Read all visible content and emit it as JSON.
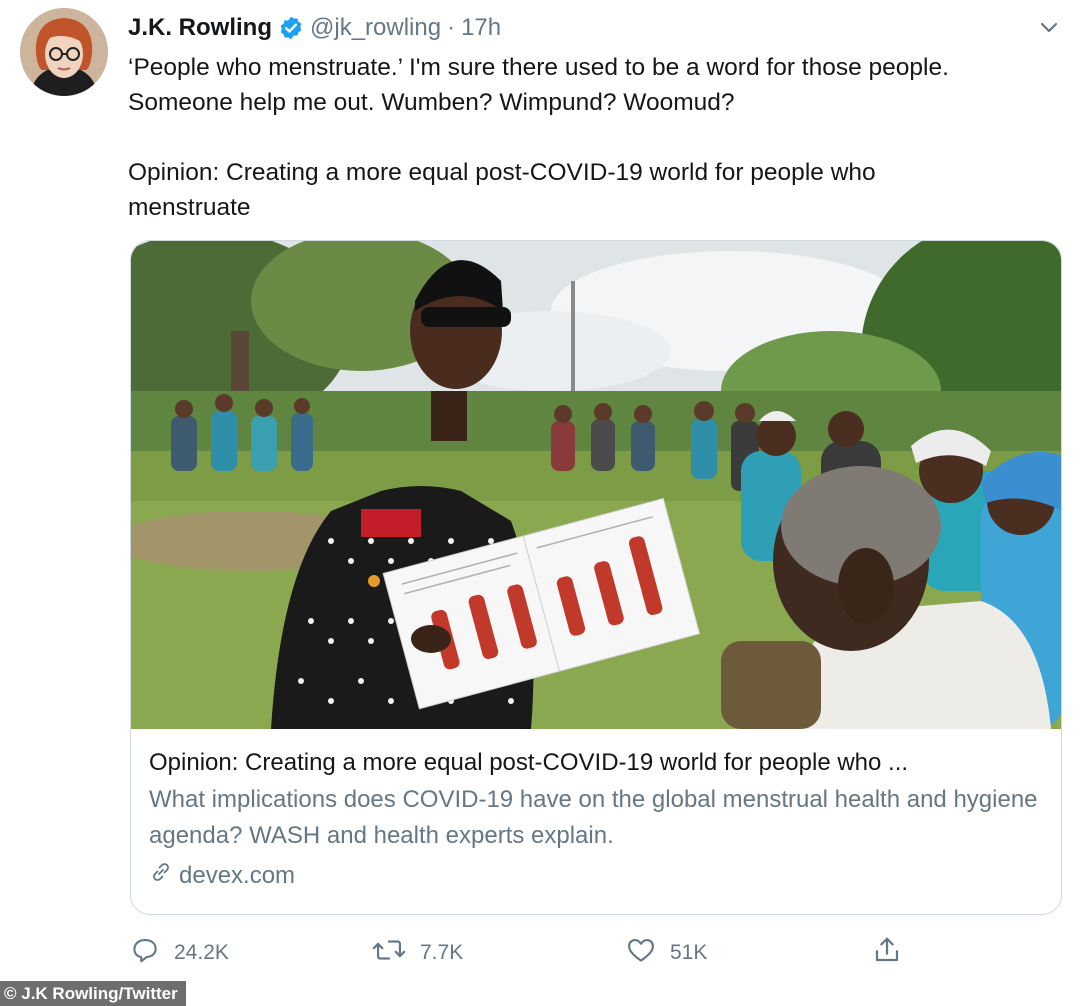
{
  "tweet": {
    "display_name": "J.K. Rowling",
    "handle": "@jk_rowling",
    "separator": "·",
    "time": "17h",
    "text": "‘People who menstruate.’ I'm sure there used to be a word for those people.\nSomeone help me out. Wumben? Wimpund? Woomud?\n\nOpinion: Creating a more equal post-COVID-19 world for people who\nmenstruate"
  },
  "card": {
    "title": "Opinion: Creating a more equal post-COVID-19 world for people who ...",
    "description": "What implications does COVID-19 have on the global menstrual health and hygiene agenda? WASH and health experts explain.",
    "domain": "devex.com"
  },
  "actions": {
    "replies": "24.2K",
    "retweets": "7.7K",
    "likes": "51K"
  },
  "credit": "© J.K Rowling/Twitter",
  "colors": {
    "verified": "#1da1f2",
    "text": "#14171a",
    "muted": "#657786",
    "border": "#cfd9de"
  },
  "icons": [
    "verified-badge-icon",
    "chevron-down-icon",
    "link-icon",
    "reply-icon",
    "retweet-icon",
    "like-icon",
    "share-icon"
  ]
}
